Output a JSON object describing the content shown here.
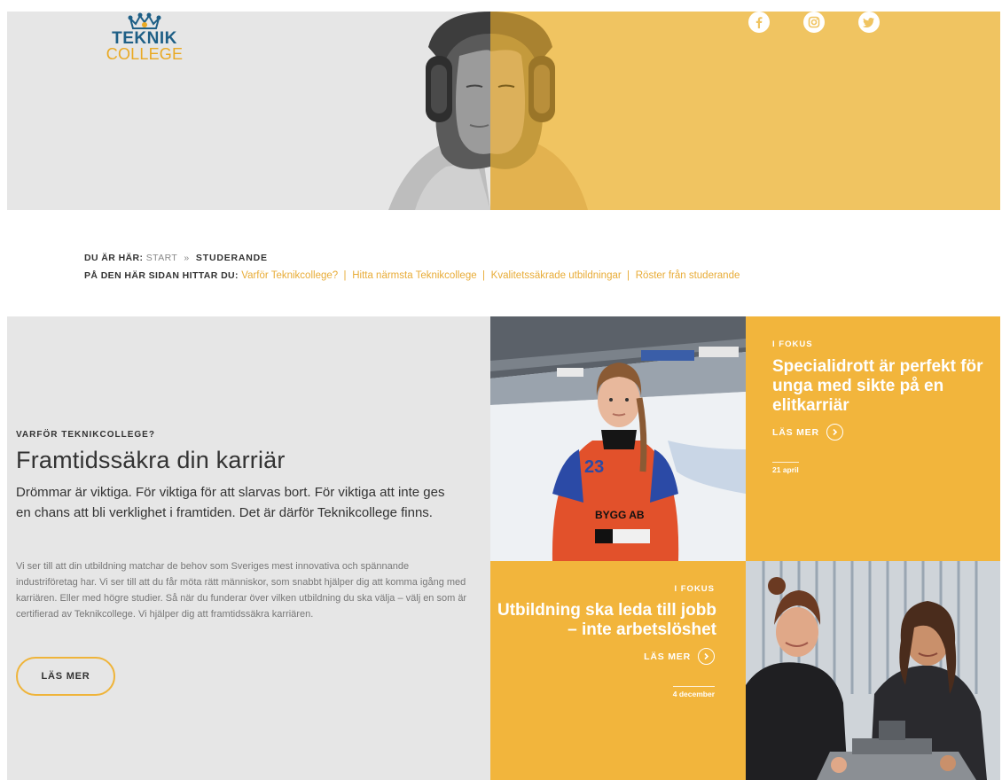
{
  "logo": {
    "line1": "TEKNIK",
    "line2": "COLLEGE"
  },
  "social": [
    {
      "name": "facebook",
      "icon": "facebook-icon"
    },
    {
      "name": "instagram",
      "icon": "instagram-icon"
    },
    {
      "name": "twitter",
      "icon": "twitter-icon"
    }
  ],
  "colors": {
    "accent": "#f2b53c",
    "hero_yellow": "#f0c461",
    "gray_bg": "#e6e6e6",
    "link": "#e8ac37",
    "logo_blue": "#1e5f86",
    "logo_gold": "#e9a923"
  },
  "breadcrumb": {
    "label": "DU ÄR HÄR:",
    "start": "START",
    "separator": "»",
    "current": "STUDERANDE"
  },
  "onpage": {
    "label": "PÅ DEN HÄR SIDAN HITTAR DU:",
    "links": [
      "Varför Teknikcollege?",
      "Hitta närmsta Teknikcollege",
      "Kvalitetssäkrade utbildningar",
      "Röster från studerande"
    ],
    "divider": "|"
  },
  "intro": {
    "eyebrow": "VARFÖR TEKNIKCOLLEGE?",
    "title": "Framtidssäkra din karriär",
    "lead": "Drömmar är viktiga. För viktiga för att slarvas bort. För viktiga att inte ges en chans att bli verklighet i framtiden. Det är därför Teknikcollege finns.",
    "body": "Vi ser till att din utbildning matchar de behov som Sveriges mest innovativa och spännande industriföretag har. Vi ser till att du får möta rätt människor, som snabbt hjälper dig att komma igång med karriären. Eller med högre studier. Så när du funderar över vilken utbildning du ska välja – välj en som är certifierad av Teknikcollege. Vi hjälper dig att framtidssäkra karriären.",
    "button": "LÄS MER"
  },
  "focus1": {
    "eyebrow": "I FOKUS",
    "title": "Specialidrott är perfekt för unga med sikte på en elitkarriär",
    "more": "LÄS MER",
    "date": "21 april"
  },
  "focus2": {
    "eyebrow": "I FOKUS",
    "title": "Utbildning ska leda till jobb – inte arbetslöshet",
    "more": "LÄS MER",
    "date": "4 december"
  },
  "photos": {
    "hockey_jersey_number": "23",
    "hockey_jersey_sponsor": "BYGG AB"
  }
}
